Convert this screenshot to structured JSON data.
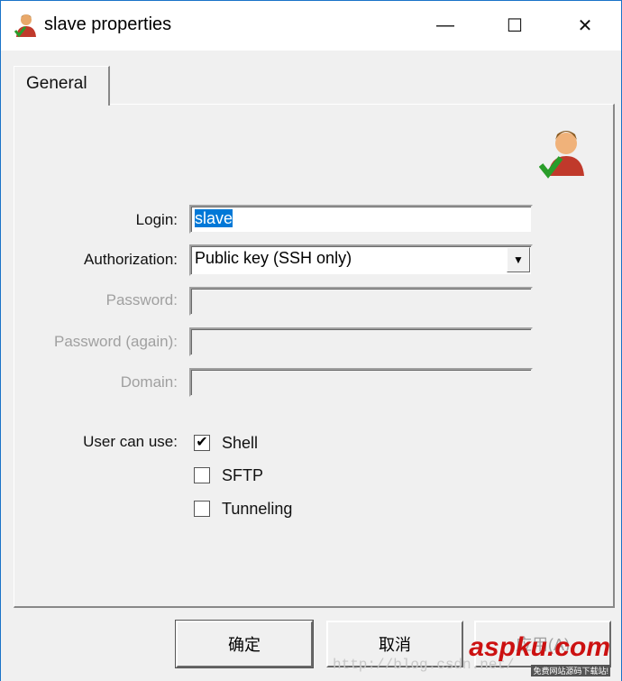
{
  "window": {
    "title": "slave properties",
    "minimize": "—",
    "maximize": "☐",
    "close": "✕"
  },
  "tabs": [
    {
      "label": "General",
      "active": true
    }
  ],
  "form": {
    "login": {
      "label": "Login:",
      "value": "slave"
    },
    "authorization": {
      "label": "Authorization:",
      "value": "Public key (SSH only)"
    },
    "password": {
      "label": "Password:",
      "value": "",
      "disabled": true
    },
    "password_again": {
      "label": "Password (again):",
      "value": "",
      "disabled": true
    },
    "domain": {
      "label": "Domain:",
      "value": "",
      "disabled": true
    },
    "user_can_use": {
      "label": "User can use:",
      "options": [
        {
          "label": "Shell",
          "checked": true
        },
        {
          "label": "SFTP",
          "checked": false
        },
        {
          "label": "Tunneling",
          "checked": false
        }
      ]
    }
  },
  "buttons": {
    "ok": "确定",
    "cancel": "取消",
    "apply": "应用(A)"
  },
  "watermark": {
    "logo": "aspku.com",
    "tagline": "免费网站源码下载站!",
    "url": "http://blog.csdn.net/"
  },
  "colors": {
    "selection": "#0078d7",
    "border": "#1a73c8"
  }
}
